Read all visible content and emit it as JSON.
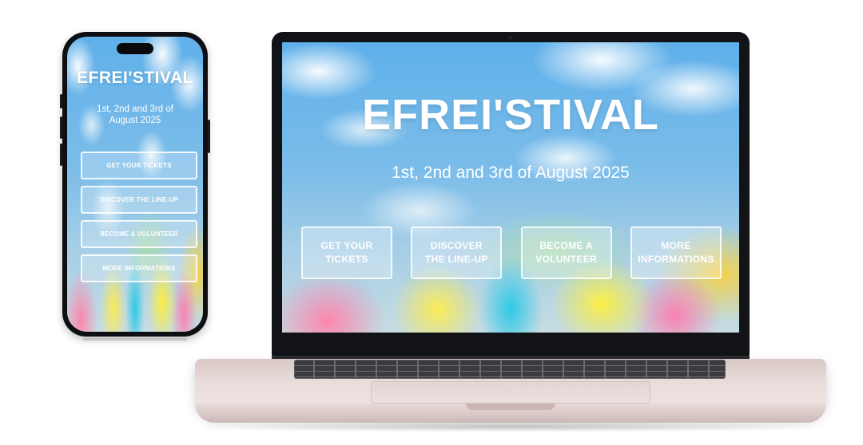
{
  "site": {
    "title": "EFREI'STIVAL",
    "dates_desktop": "1st, 2nd and 3rd of August 2025",
    "dates_mobile": "1st, 2nd and 3rd of August 2025"
  },
  "buttons": {
    "tickets": "GET YOUR TICKETS",
    "lineup": "DISCOVER THE LINE-UP",
    "volunteer": "BECOME A VOLUNTEER",
    "info": "MORE INFORMATIONS"
  },
  "colors": {
    "sky": "#5fb0ea",
    "text": "#ffffff",
    "device_frame": "#121316",
    "laptop_body": "#e9dcda"
  }
}
